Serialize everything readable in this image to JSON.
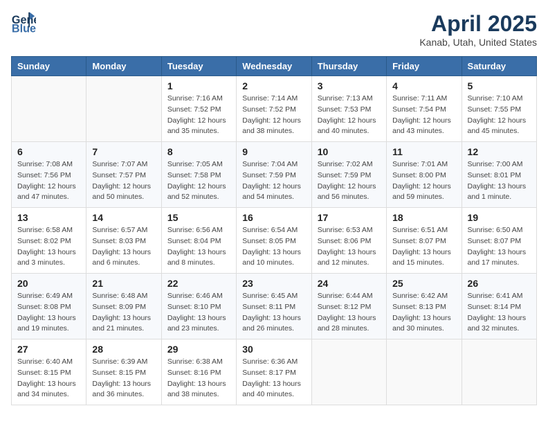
{
  "header": {
    "logo_line1": "General",
    "logo_line2": "Blue",
    "title": "April 2025",
    "subtitle": "Kanab, Utah, United States"
  },
  "weekdays": [
    "Sunday",
    "Monday",
    "Tuesday",
    "Wednesday",
    "Thursday",
    "Friday",
    "Saturday"
  ],
  "weeks": [
    [
      {
        "day": "",
        "info": ""
      },
      {
        "day": "",
        "info": ""
      },
      {
        "day": "1",
        "info": "Sunrise: 7:16 AM\nSunset: 7:52 PM\nDaylight: 12 hours\nand 35 minutes."
      },
      {
        "day": "2",
        "info": "Sunrise: 7:14 AM\nSunset: 7:52 PM\nDaylight: 12 hours\nand 38 minutes."
      },
      {
        "day": "3",
        "info": "Sunrise: 7:13 AM\nSunset: 7:53 PM\nDaylight: 12 hours\nand 40 minutes."
      },
      {
        "day": "4",
        "info": "Sunrise: 7:11 AM\nSunset: 7:54 PM\nDaylight: 12 hours\nand 43 minutes."
      },
      {
        "day": "5",
        "info": "Sunrise: 7:10 AM\nSunset: 7:55 PM\nDaylight: 12 hours\nand 45 minutes."
      }
    ],
    [
      {
        "day": "6",
        "info": "Sunrise: 7:08 AM\nSunset: 7:56 PM\nDaylight: 12 hours\nand 47 minutes."
      },
      {
        "day": "7",
        "info": "Sunrise: 7:07 AM\nSunset: 7:57 PM\nDaylight: 12 hours\nand 50 minutes."
      },
      {
        "day": "8",
        "info": "Sunrise: 7:05 AM\nSunset: 7:58 PM\nDaylight: 12 hours\nand 52 minutes."
      },
      {
        "day": "9",
        "info": "Sunrise: 7:04 AM\nSunset: 7:59 PM\nDaylight: 12 hours\nand 54 minutes."
      },
      {
        "day": "10",
        "info": "Sunrise: 7:02 AM\nSunset: 7:59 PM\nDaylight: 12 hours\nand 56 minutes."
      },
      {
        "day": "11",
        "info": "Sunrise: 7:01 AM\nSunset: 8:00 PM\nDaylight: 12 hours\nand 59 minutes."
      },
      {
        "day": "12",
        "info": "Sunrise: 7:00 AM\nSunset: 8:01 PM\nDaylight: 13 hours\nand 1 minute."
      }
    ],
    [
      {
        "day": "13",
        "info": "Sunrise: 6:58 AM\nSunset: 8:02 PM\nDaylight: 13 hours\nand 3 minutes."
      },
      {
        "day": "14",
        "info": "Sunrise: 6:57 AM\nSunset: 8:03 PM\nDaylight: 13 hours\nand 6 minutes."
      },
      {
        "day": "15",
        "info": "Sunrise: 6:56 AM\nSunset: 8:04 PM\nDaylight: 13 hours\nand 8 minutes."
      },
      {
        "day": "16",
        "info": "Sunrise: 6:54 AM\nSunset: 8:05 PM\nDaylight: 13 hours\nand 10 minutes."
      },
      {
        "day": "17",
        "info": "Sunrise: 6:53 AM\nSunset: 8:06 PM\nDaylight: 13 hours\nand 12 minutes."
      },
      {
        "day": "18",
        "info": "Sunrise: 6:51 AM\nSunset: 8:07 PM\nDaylight: 13 hours\nand 15 minutes."
      },
      {
        "day": "19",
        "info": "Sunrise: 6:50 AM\nSunset: 8:07 PM\nDaylight: 13 hours\nand 17 minutes."
      }
    ],
    [
      {
        "day": "20",
        "info": "Sunrise: 6:49 AM\nSunset: 8:08 PM\nDaylight: 13 hours\nand 19 minutes."
      },
      {
        "day": "21",
        "info": "Sunrise: 6:48 AM\nSunset: 8:09 PM\nDaylight: 13 hours\nand 21 minutes."
      },
      {
        "day": "22",
        "info": "Sunrise: 6:46 AM\nSunset: 8:10 PM\nDaylight: 13 hours\nand 23 minutes."
      },
      {
        "day": "23",
        "info": "Sunrise: 6:45 AM\nSunset: 8:11 PM\nDaylight: 13 hours\nand 26 minutes."
      },
      {
        "day": "24",
        "info": "Sunrise: 6:44 AM\nSunset: 8:12 PM\nDaylight: 13 hours\nand 28 minutes."
      },
      {
        "day": "25",
        "info": "Sunrise: 6:42 AM\nSunset: 8:13 PM\nDaylight: 13 hours\nand 30 minutes."
      },
      {
        "day": "26",
        "info": "Sunrise: 6:41 AM\nSunset: 8:14 PM\nDaylight: 13 hours\nand 32 minutes."
      }
    ],
    [
      {
        "day": "27",
        "info": "Sunrise: 6:40 AM\nSunset: 8:15 PM\nDaylight: 13 hours\nand 34 minutes."
      },
      {
        "day": "28",
        "info": "Sunrise: 6:39 AM\nSunset: 8:15 PM\nDaylight: 13 hours\nand 36 minutes."
      },
      {
        "day": "29",
        "info": "Sunrise: 6:38 AM\nSunset: 8:16 PM\nDaylight: 13 hours\nand 38 minutes."
      },
      {
        "day": "30",
        "info": "Sunrise: 6:36 AM\nSunset: 8:17 PM\nDaylight: 13 hours\nand 40 minutes."
      },
      {
        "day": "",
        "info": ""
      },
      {
        "day": "",
        "info": ""
      },
      {
        "day": "",
        "info": ""
      }
    ]
  ]
}
